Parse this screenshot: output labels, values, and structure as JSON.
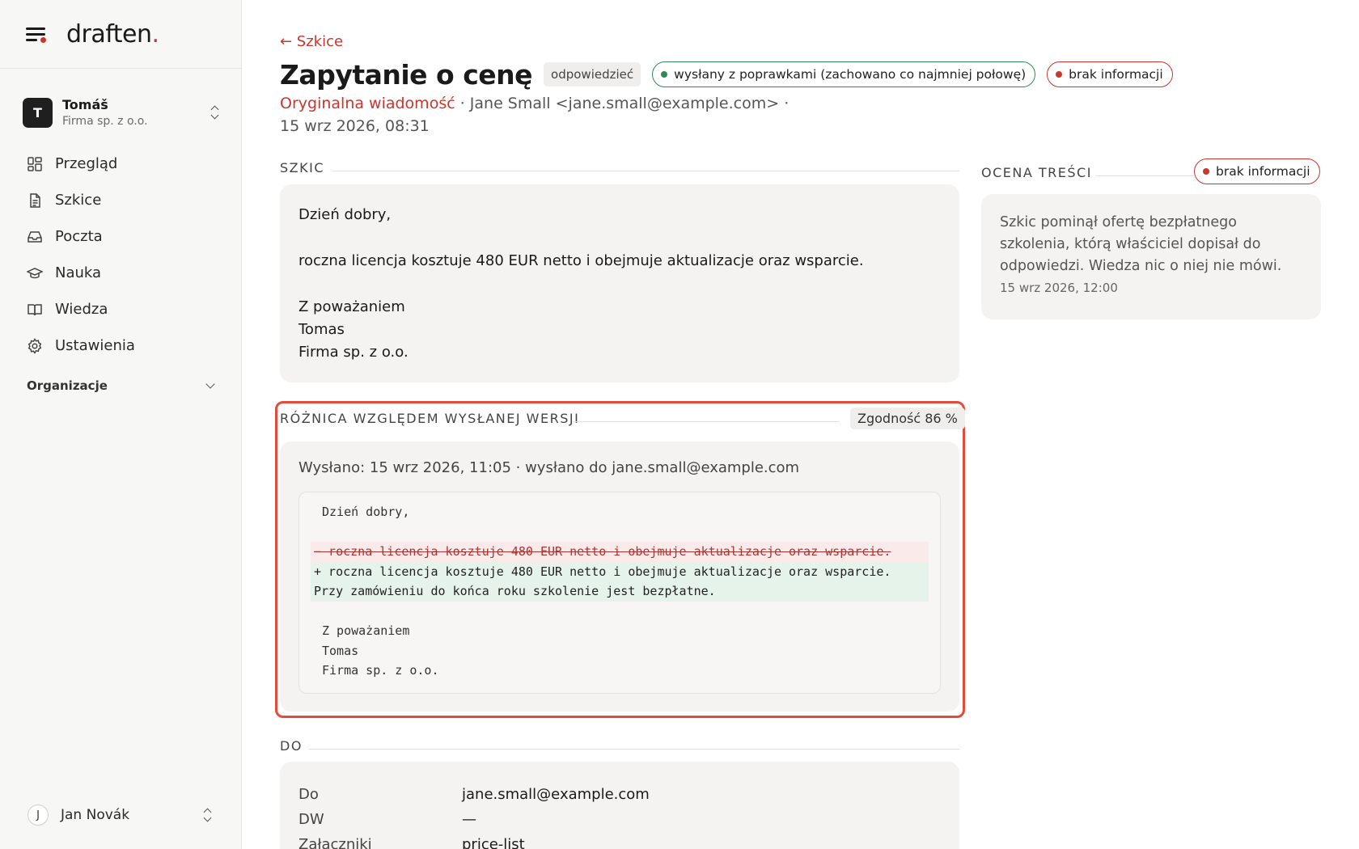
{
  "app": {
    "logo": "draften",
    "logo_dot": "."
  },
  "account": {
    "initial": "T",
    "name": "Tomáš",
    "company": "Firma sp. z o.o."
  },
  "nav": [
    {
      "label": "Przegląd",
      "icon": "dashboard-icon"
    },
    {
      "label": "Szkice",
      "icon": "document-icon"
    },
    {
      "label": "Poczta",
      "icon": "inbox-icon"
    },
    {
      "label": "Nauka",
      "icon": "graduation-cap-icon"
    },
    {
      "label": "Wiedza",
      "icon": "book-icon"
    },
    {
      "label": "Ustawienia",
      "icon": "gear-icon"
    }
  ],
  "organizations_label": "Organizacje",
  "user": {
    "initial": "J",
    "name": "Jan Novák"
  },
  "header": {
    "back": "← Szkice",
    "title": "Zapytanie o cenę",
    "type_tag": "odpowiedzieć",
    "status_pill": "wysłany z poprawkami (zachowano co najmniej połowę)",
    "info_pill": "brak informacji",
    "original_link": "Oryginalna wiadomość",
    "meta_rest": " · Jane Small <jane.small@example.com> · 15 wrz 2026, 08:31"
  },
  "draft": {
    "section_label": "SZKIC",
    "greeting": "Dzień dobry,",
    "body": "roczna licencja kosztuje 480 EUR netto i obejmuje aktualizacje oraz wsparcie.",
    "closing": "Z poważaniem",
    "name": "Tomas",
    "company": "Firma sp. z o.o."
  },
  "diff": {
    "section_label": "RÓŻNICA WZGLĘDEM WYSŁANEJ WERSJI",
    "score": "Zgodność 86 %",
    "sent_info": "Wysłano: 15 wrz 2026, 11:05 · wysłano do jane.small@example.com",
    "lines": {
      "greeting": "Dzień dobry,",
      "removed": "− roczna licencja kosztuje 480 EUR netto i obejmuje aktualizacje oraz wsparcie.",
      "added_1": "+ roczna licencja kosztuje 480 EUR netto i obejmuje aktualizacje oraz wsparcie.",
      "added_2": "Przy zamówieniu do końca roku szkolenie jest bezpłatne.",
      "closing": "Z poważaniem",
      "name": "Tomas",
      "company": "Firma sp. z o.o."
    }
  },
  "recipients": {
    "section_label": "DO",
    "rows": [
      {
        "key": "Do",
        "value": "jane.small@example.com"
      },
      {
        "key": "DW",
        "value": "—"
      },
      {
        "key": "Załączniki",
        "value": "price-list"
      }
    ]
  },
  "review": {
    "section_label": "OCENA TREŚCI",
    "badge": "brak informacji",
    "text": "Szkic pominął ofertę bezpłatnego szkolenia, którą właściciel dopisał do odpowiedzi. Wiedza nic o niej nie mówi.",
    "date": "15 wrz 2026, 12:00"
  },
  "colors": {
    "accent": "#c8372d",
    "success": "#2e8a57",
    "highlight_frame": "#e24d3b"
  }
}
